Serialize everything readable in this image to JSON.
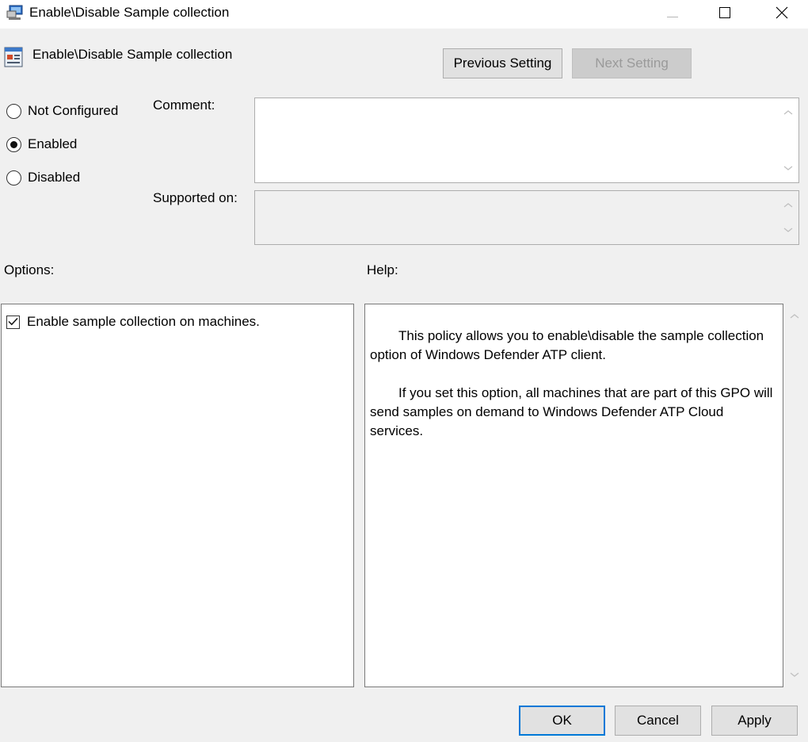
{
  "window": {
    "title": "Enable\\Disable Sample collection",
    "controls": {
      "minimize": "minimize-icon",
      "maximize": "maximize-icon",
      "close": "close-icon"
    }
  },
  "header": {
    "title": "Enable\\Disable Sample collection",
    "icon": "policy-setting-icon"
  },
  "nav": {
    "previous_label": "Previous Setting",
    "next_label": "Next Setting"
  },
  "state": {
    "options": [
      {
        "label": "Not Configured",
        "selected": false
      },
      {
        "label": "Enabled",
        "selected": true
      },
      {
        "label": "Disabled",
        "selected": false
      }
    ]
  },
  "fields": {
    "comment_label": "Comment:",
    "comment_value": "",
    "supported_label": "Supported on:",
    "supported_value": ""
  },
  "options_panel": {
    "label": "Options:",
    "checkbox_label": "Enable sample collection on machines.",
    "checkbox_checked": true
  },
  "help_panel": {
    "label": "Help:",
    "paragraphs": [
      "This policy allows you to enable\\disable the sample collection option of Windows Defender ATP client.",
      "If you set this option, all machines that are part of this GPO will send samples on demand to Windows Defender ATP Cloud services."
    ]
  },
  "footer": {
    "ok_label": "OK",
    "cancel_label": "Cancel",
    "apply_label": "Apply"
  },
  "colors": {
    "default_button_border": "#0078d7",
    "dialog_background": "#f0f0f0"
  }
}
